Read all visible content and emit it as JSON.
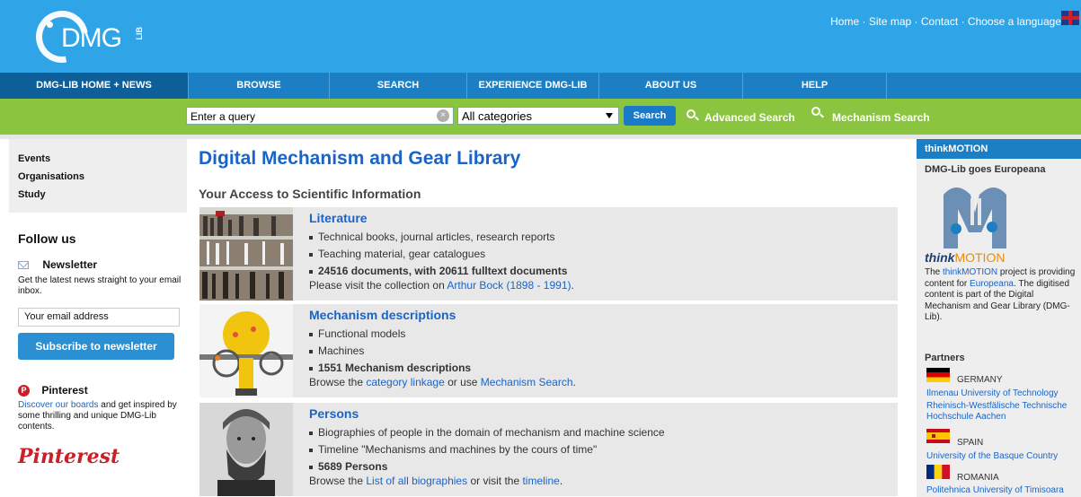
{
  "header": {
    "logo_text": "DMG",
    "logo_suffix": "LIB",
    "links": [
      "Home",
      "Site map",
      "Contact",
      "Choose a language"
    ],
    "separator": "·"
  },
  "nav": {
    "items": [
      "DMG-LIB HOME + NEWS",
      "BROWSE",
      "SEARCH",
      "EXPERIENCE DMG-LIB",
      "ABOUT US",
      "HELP"
    ]
  },
  "search": {
    "query_placeholder": "Enter a query",
    "category_selected": "All categories",
    "button_label": "Search",
    "advanced_label": "Advanced Search",
    "mechanism_label": "Mechanism Search"
  },
  "leftnav": {
    "items": [
      "Events",
      "Organisations",
      "Study"
    ]
  },
  "follow": {
    "title": "Follow us",
    "newsletter_title": "Newsletter",
    "newsletter_text": "Get the latest news straight to your email inbox.",
    "email_placeholder": "Your email address",
    "subscribe_label": "Subscribe to newsletter",
    "pinterest_title": "Pinterest",
    "pinterest_link": "Discover our boards",
    "pinterest_text": " and get inspired by some thrilling and unique DMG-Lib contents.",
    "pinterest_logo": "Pinterest"
  },
  "main": {
    "title": "Digital Mechanism and Gear Library",
    "subtitle": "Your Access to Scientific Information",
    "blocks": [
      {
        "title": "Literature",
        "bullets": [
          "Technical books, journal articles, research reports",
          "Teaching material, gear catalogues"
        ],
        "strong": "24516 documents, with 20611 fulltext documents",
        "bottom_pre": "Please visit the collection on ",
        "bottom_link1": "Arthur Bock (1898 - 1991)",
        "bottom_mid": "",
        "bottom_link2": "",
        "bottom_post": "."
      },
      {
        "title": "Mechanism descriptions",
        "bullets": [
          "Functional models",
          "Machines"
        ],
        "strong": "1551 Mechanism descriptions",
        "bottom_pre": "Browse the ",
        "bottom_link1": "category linkage",
        "bottom_mid": " or use ",
        "bottom_link2": "Mechanism Search",
        "bottom_post": "."
      },
      {
        "title": "Persons",
        "bullets": [
          "Biographies of people in the domain of mechanism and machine science",
          "Timeline \"Mechanisms and machines by the cours of time\""
        ],
        "strong": "5689 Persons",
        "bottom_pre": "Browse the ",
        "bottom_link1": "List of all biographies",
        "bottom_mid": " or visit the ",
        "bottom_link2": "timeline",
        "bottom_post": "."
      }
    ]
  },
  "right": {
    "header": "thinkMOTION",
    "euro_title": "DMG-Lib goes Europeana",
    "tm_think": "think",
    "tm_motion": "MOTION",
    "desc_pre": "The ",
    "desc_link1": "thinkMOTION",
    "desc_mid": " project is providing content for ",
    "desc_link2": "Europeana",
    "desc_post": ". The digitised content is part of the Digital Mechanism and Gear Library (DMG-Lib).",
    "partners_title": "Partners",
    "partners": [
      {
        "country": "GERMANY",
        "universities": [
          "Ilmenau University of Technology",
          "Rheinisch-Westfälische Technische Hochschule Aachen"
        ]
      },
      {
        "country": "SPAIN",
        "universities": [
          "University of the Basque Country"
        ]
      },
      {
        "country": "ROMANIA",
        "universities": [
          "Politehnica University of Timisoara"
        ]
      }
    ]
  }
}
